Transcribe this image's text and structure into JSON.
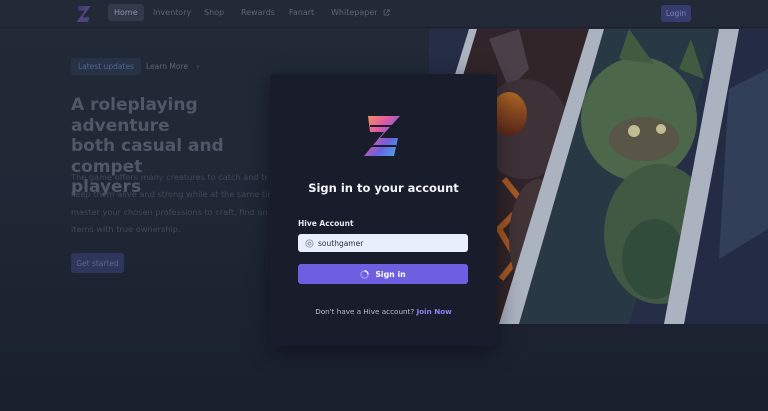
{
  "nav": {
    "links": [
      {
        "label": "Home"
      },
      {
        "label": "Inventory"
      },
      {
        "label": "Shop"
      },
      {
        "label": "Rewards"
      },
      {
        "label": "Fanart"
      },
      {
        "label": "Whitepaper"
      }
    ],
    "login_label": "Login",
    "whitepaper_icon": "external-link-icon"
  },
  "hero": {
    "pill_label": "Latest updates",
    "learn_more_label": "Learn More",
    "title_lines": [
      "A roleplaying adventure",
      "both casual and compet",
      "players"
    ],
    "desc_lines": [
      "The game offers many creatures to catch and tr",
      "keep them alive and strong while at the same tin",
      "master your chosen professions to craft, find an",
      "items with true ownership."
    ],
    "get_started_label": "Get started"
  },
  "modal": {
    "title": "Sign in to your account",
    "field_label": "Hive Account",
    "username_value": "southgamer",
    "signin_label": "Sign in",
    "footer_text": "Don't have a Hive account?",
    "join_label": "Join Now",
    "accent_color": "#6d5fe0"
  }
}
